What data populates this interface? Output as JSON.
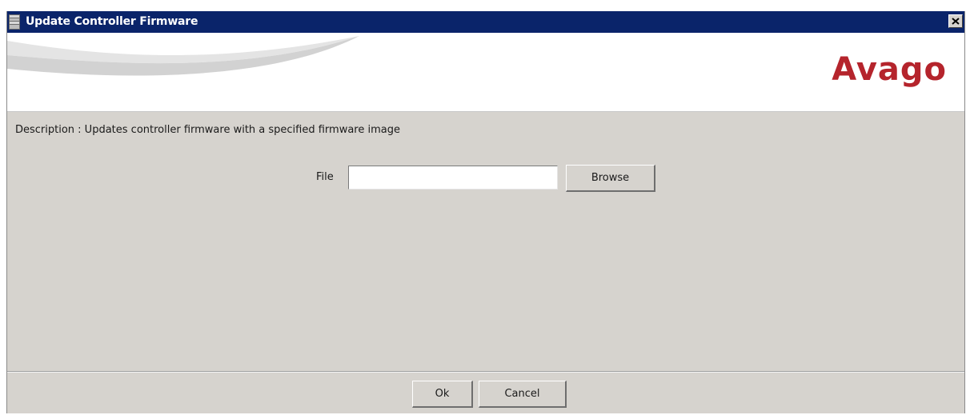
{
  "window": {
    "title": "Update Controller Firmware",
    "icon": "server-icon",
    "close_icon": "close-icon"
  },
  "banner": {
    "logo_text": "Avago",
    "logo_color": "#b5242c"
  },
  "description": "Description : Updates controller firmware with a specified firmware image",
  "file": {
    "label": "File",
    "value": "",
    "placeholder": "",
    "browse_label": "Browse"
  },
  "footer": {
    "ok_label": "Ok",
    "cancel_label": "Cancel"
  },
  "colors": {
    "titlebar": "#0a246a",
    "dialog_bg": "#d6d3ce"
  }
}
